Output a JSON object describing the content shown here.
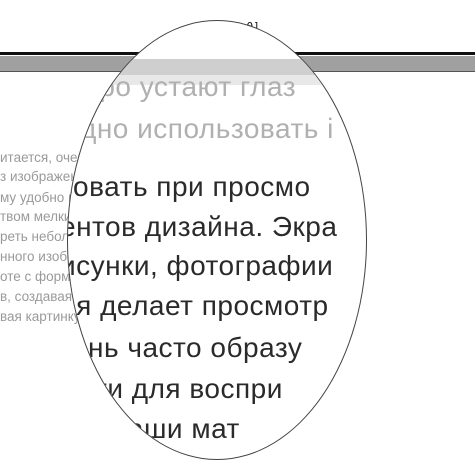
{
  "magnifier": {
    "zoom_label": "[x2.0]"
  },
  "document": {
    "lines": [
      "итается, очень быстро устают глаза. Для увеличения ло",
      "з изображения при просмотре, используйте. Экранная",
      "му удобно использовать при просмотре веб-страниц с бо",
      "твом мелких элементов дизайна. Экранная лупа помогае",
      "реть небольшие рисунки, фотографии. Режим сглаживан",
      "нного изображения делает просмотр приятным для",
      "оте с формулами очень часто образуется нагромождение",
      "в, создавая трудности для восприятия. Экранная лупа,",
      "вая картинку, упрощает ваши математические будни."
    ]
  },
  "lens_text": {
    "lines": [
      "тро устают глаз",
      "дно использовать і",
      "зовать при просмо",
      "ентов дизайна. Экра",
      "исунки, фотографии",
      "ия делает просмотр",
      "нень часто образу",
      "юсти для воспри",
      "ает ваши мат"
    ]
  }
}
